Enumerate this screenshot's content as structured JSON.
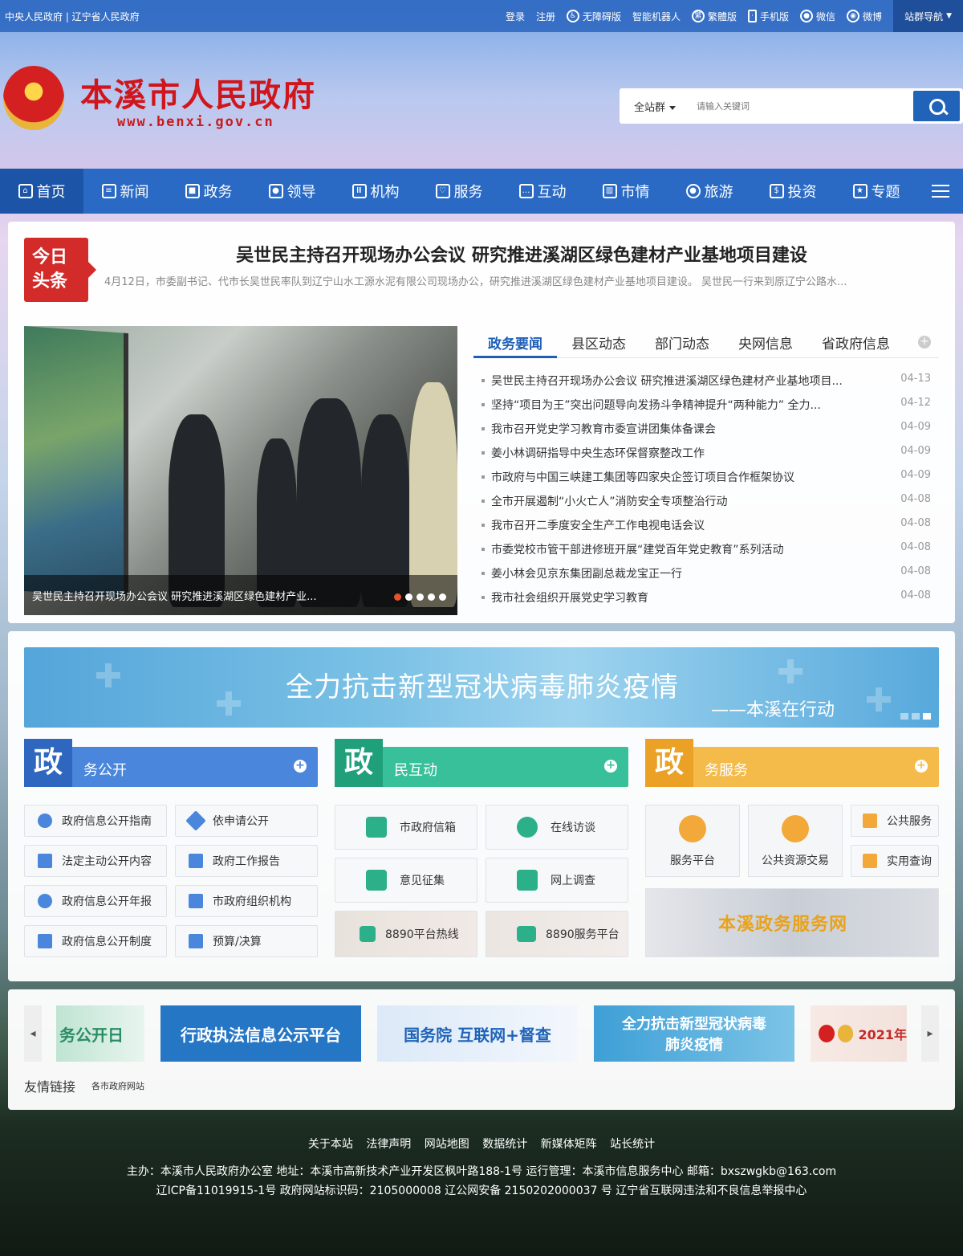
{
  "topbar": {
    "left_text": "中央人民政府 | 辽宁省人民政府",
    "items": [
      {
        "label": "登录"
      },
      {
        "label": "注册"
      },
      {
        "label": "无障碍版",
        "icon": "accessibility-icon"
      },
      {
        "label": "智能机器人"
      },
      {
        "label": "繁體版",
        "icon": "traditional-chinese-icon"
      },
      {
        "label": "手机版",
        "icon": "mobile-icon"
      },
      {
        "label": "微信",
        "icon": "wechat-icon"
      },
      {
        "label": "微博",
        "icon": "weibo-icon"
      }
    ],
    "site_nav": "站群导航"
  },
  "header": {
    "title": "本溪市人民政府",
    "url": "www.benxi.gov.cn",
    "search": {
      "scope": "全站群",
      "placeholder": "请输入关键词"
    }
  },
  "nav": [
    {
      "label": "首页",
      "icon": "home-icon"
    },
    {
      "label": "新闻",
      "icon": "news-icon"
    },
    {
      "label": "政务",
      "icon": "government-affairs-icon"
    },
    {
      "label": "领导",
      "icon": "leader-icon"
    },
    {
      "label": "机构",
      "icon": "institution-icon"
    },
    {
      "label": "服务",
      "icon": "service-icon"
    },
    {
      "label": "互动",
      "icon": "interaction-icon"
    },
    {
      "label": "市情",
      "icon": "city-info-icon"
    },
    {
      "label": "旅游",
      "icon": "tourism-icon"
    },
    {
      "label": "投资",
      "icon": "investment-icon"
    },
    {
      "label": "专题",
      "icon": "topic-icon"
    }
  ],
  "headline": {
    "badge_line1": "今日",
    "badge_line2": "头条",
    "title": "吴世民主持召开现场办公会议 研究推进溪湖区绿色建材产业基地项目建设",
    "summary": "4月12日，市委副书记、代市长吴世民率队到辽宁山水工源水泥有限公司现场办公，研究推进溪湖区绿色建材产业基地项目建设。    吴世民一行来到原辽宁公路水..."
  },
  "photo": {
    "caption": "吴世民主持召开现场办公会议 研究推进溪湖区绿色建材产业...",
    "slide_index": 1,
    "slide_total": 5
  },
  "news_tabs": [
    "政务要闻",
    "县区动态",
    "部门动态",
    "央网信息",
    "省政府信息"
  ],
  "news": [
    {
      "title": "吴世民主持召开现场办公会议 研究推进溪湖区绿色建材产业基地项目...",
      "date": "04-13"
    },
    {
      "title": "坚持“项目为王”突出问题导向发扬斗争精神提升“两种能力” 全力...",
      "date": "04-12"
    },
    {
      "title": "我市召开党史学习教育市委宣讲团集体备课会",
      "date": "04-09"
    },
    {
      "title": "姜小林调研指导中央生态环保督察整改工作",
      "date": "04-09"
    },
    {
      "title": "市政府与中国三峡建工集团等四家央企签订项目合作框架协议",
      "date": "04-09"
    },
    {
      "title": "全市开展遏制“小火亡人”消防安全专项整治行动",
      "date": "04-08"
    },
    {
      "title": "我市召开二季度安全生产工作电视电话会议",
      "date": "04-08"
    },
    {
      "title": "市委党校市管干部进修班开展“建党百年党史教育”系列活动",
      "date": "04-08"
    },
    {
      "title": "姜小林会见京东集团副总裁龙宝正一行",
      "date": "04-08"
    },
    {
      "title": "我市社会组织开展党史学习教育",
      "date": "04-08"
    }
  ],
  "banner": {
    "main": "全力抗击新型冠状病毒肺炎疫情",
    "sub": "——本溪在行动"
  },
  "sections": {
    "open": {
      "char": "政",
      "label": "务公开",
      "color": "#3f7fd6",
      "items": [
        {
          "label": "政府信息公开指南",
          "icon": "compass-icon"
        },
        {
          "label": "依申请公开",
          "icon": "paper-plane-icon"
        },
        {
          "label": "法定主动公开内容",
          "icon": "layers-icon"
        },
        {
          "label": "政府工作报告",
          "icon": "pencil-icon"
        },
        {
          "label": "政府信息公开年报",
          "icon": "pie-chart-icon"
        },
        {
          "label": "市政府组织机构",
          "icon": "org-chart-icon"
        },
        {
          "label": "政府信息公开制度",
          "icon": "bar-chart-icon"
        },
        {
          "label": "预算/决算",
          "icon": "line-chart-icon"
        }
      ]
    },
    "interact": {
      "char": "政",
      "label": "民互动",
      "color": "#2bb08a",
      "items": [
        {
          "label": "市政府信箱",
          "icon": "mail-icon"
        },
        {
          "label": "在线访谈",
          "icon": "interview-icon"
        },
        {
          "label": "意见征集",
          "icon": "document-icon"
        },
        {
          "label": "网上调查",
          "icon": "survey-icon"
        },
        {
          "label": "8890平台热线",
          "icon": "phone-icon"
        },
        {
          "label": "8890服务平台",
          "icon": "people-icon"
        }
      ]
    },
    "service": {
      "char": "政",
      "label": "务服务",
      "color": "#f0a92b",
      "items": [
        {
          "label": "服务平台",
          "icon": "service-hand-icon"
        },
        {
          "label": "公共资源交易",
          "icon": "resource-trade-icon"
        },
        {
          "label": "公共服务",
          "icon": "laptop-icon"
        },
        {
          "label": "实用查询",
          "icon": "search-query-icon"
        }
      ],
      "banner": "本溪政务服务网"
    }
  },
  "links": {
    "cards": [
      {
        "text": "务公开日"
      },
      {
        "text": "行政执法信息公示平台"
      },
      {
        "text": "国务院 互联网+督查"
      },
      {
        "text": "全力抗击新型冠状病毒肺炎疫情"
      },
      {
        "text": "2021年"
      }
    ],
    "friend_label": "友情链接",
    "friend_select": "各市政府网站"
  },
  "footer": {
    "links": [
      "关于本站",
      "法律声明",
      "网站地图",
      "数据统计",
      "新媒体矩阵",
      "站长统计"
    ],
    "line1": "主办：本溪市人民政府办公室   地址：本溪市高新技术产业开发区枫叶路188-1号   运行管理：本溪市信息服务中心   邮箱：bxszwgkb@163.com",
    "line2": "辽ICP备11019915-1号   政府网站标识码：2105000008   辽公网安备 2150202000037 号   辽宁省互联网违法和不良信息举报中心"
  }
}
